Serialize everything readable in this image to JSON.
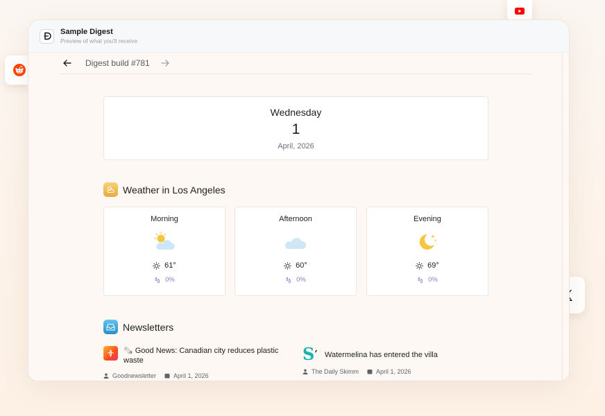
{
  "header": {
    "title": "Sample Digest",
    "subtitle": "Preview of what you'll receive"
  },
  "toolbar": {
    "build_label": "Digest build #781"
  },
  "date": {
    "weekday": "Wednesday",
    "day": "1",
    "month_year": "April, 2026"
  },
  "weather": {
    "title": "Weather in Los Angeles",
    "periods": [
      {
        "label": "Morning",
        "icon": "partly-cloudy-sun-icon",
        "temp": "61°",
        "rain": "0%"
      },
      {
        "label": "Afternoon",
        "icon": "cloud-icon",
        "temp": "60°",
        "rain": "0%"
      },
      {
        "label": "Evening",
        "icon": "moon-stars-icon",
        "temp": "69°",
        "rain": "0%"
      }
    ]
  },
  "newsletters": {
    "title": "Newsletters",
    "items": [
      {
        "title": "🗞️ Good News: Canadian city reduces plastic waste",
        "source": "Goodnewsletter",
        "date": "April 1, 2026",
        "icon": "goodnewsletter-logo"
      },
      {
        "title": "Watermelina has entered the villa",
        "source": "The Daily Skimm",
        "date": "April 1, 2026",
        "icon": "skimm-logo"
      }
    ]
  },
  "floating_icons": [
    "youtube-icon",
    "reddit-icon",
    "x-icon"
  ],
  "colors": {
    "youtube": "#ff0000",
    "reddit": "#ff4500",
    "weather_accent": "#f2c14e",
    "newsletter_accent": "#3fa6d9",
    "rain_text": "#7a80c8"
  }
}
